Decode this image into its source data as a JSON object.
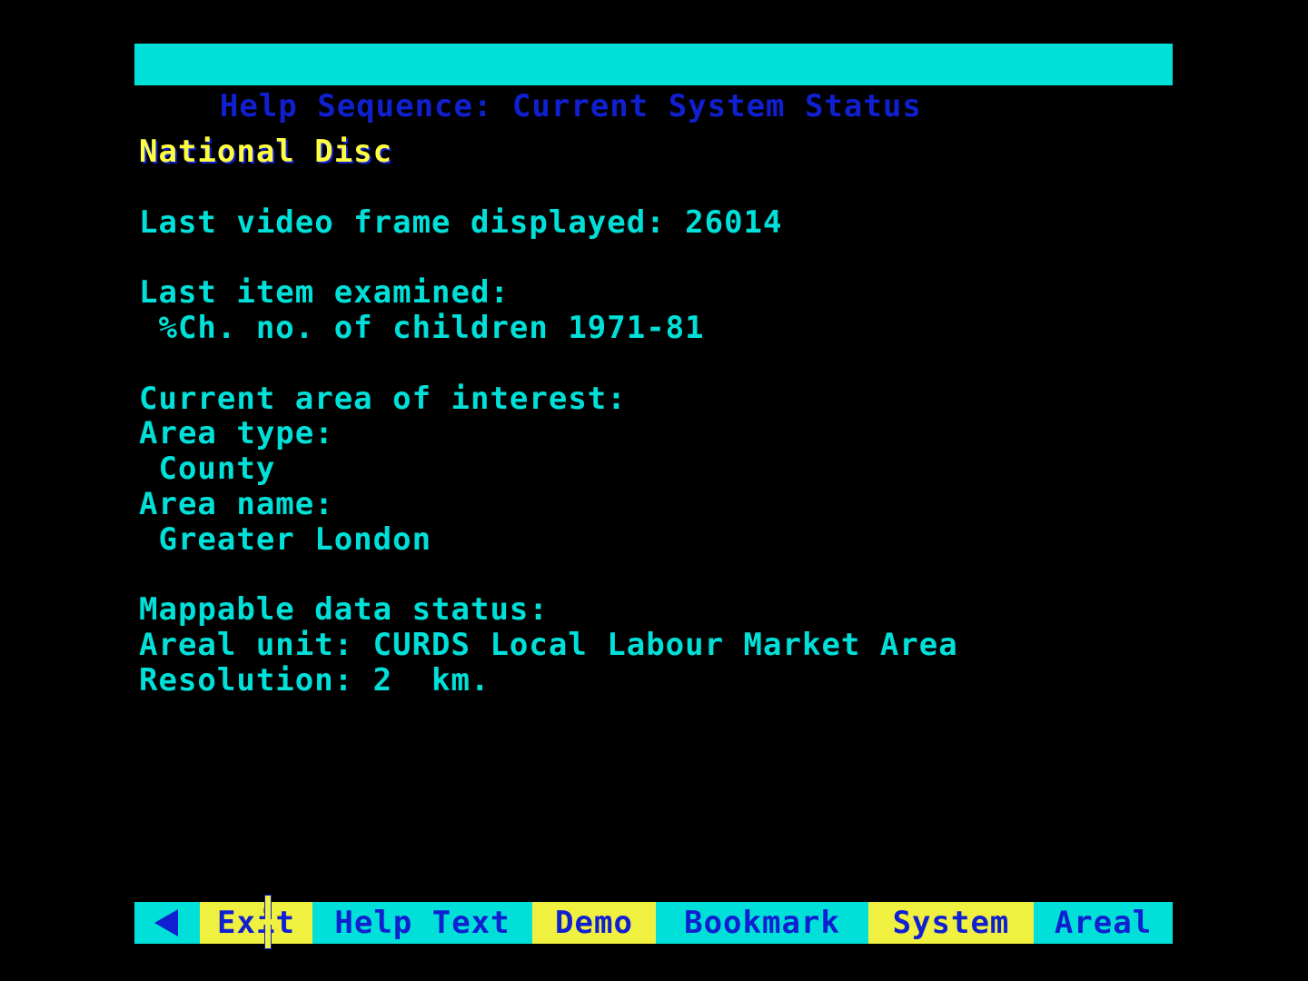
{
  "title_bar": {
    "text": "Help Sequence: Current System Status"
  },
  "content": {
    "heading": "National Disc",
    "last_frame_line": "Last video frame displayed: 26014",
    "last_item_label": "Last item examined:",
    "last_item_value": " %Ch. no. of children 1971-81",
    "area_label": "Current area of interest:",
    "area_type_label": "Area type:",
    "area_type_value": " County",
    "area_name_label": "Area name:",
    "area_name_value": " Greater London",
    "mappable_label": "Mappable data status:",
    "areal_unit_line": "Areal unit: CURDS Local Labour Market Area",
    "resolution_line": "Resolution: 2  km."
  },
  "nav": {
    "back_icon": "left-arrow-icon",
    "exit_label": "Exit",
    "help_text_label": "Help Text",
    "demo_label": "Demo",
    "bookmark_label": "Bookmark",
    "system_label": "System",
    "areal_label": "Areal"
  },
  "colors": {
    "background": "#000000",
    "cyan": "#00e0d8",
    "yellow": "#f0f040",
    "blue": "#1020d0"
  }
}
